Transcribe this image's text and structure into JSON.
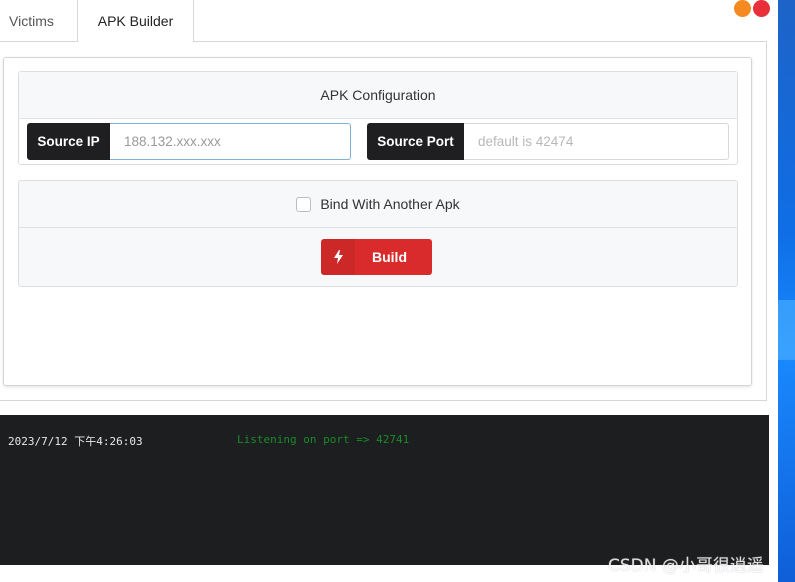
{
  "tabs": [
    {
      "label": "Victims",
      "active": false
    },
    {
      "label": "APK Builder",
      "active": true
    }
  ],
  "config": {
    "title": "APK Configuration",
    "source_ip_label": "Source IP",
    "source_ip_placeholder": "188.132.xxx.xxx",
    "source_port_label": "Source Port",
    "source_port_placeholder": "default is 42474"
  },
  "build": {
    "bind_label": "Bind With Another Apk",
    "bind_checked": false,
    "button_label": "Build",
    "button_icon": "bolt-icon"
  },
  "console": {
    "lines": [
      {
        "time": "2023/7/12 下午4:26:03",
        "message": "Listening on port => 42741"
      }
    ]
  },
  "watermark": "CSDN @小哥很逍遥",
  "colors": {
    "accent_red": "#d92b2b",
    "label_dark": "#1f1f22",
    "console_bg": "#1d1e20",
    "console_message": "#1a8a2a",
    "window_orange": "#f58a20",
    "window_red": "#e8303a"
  }
}
